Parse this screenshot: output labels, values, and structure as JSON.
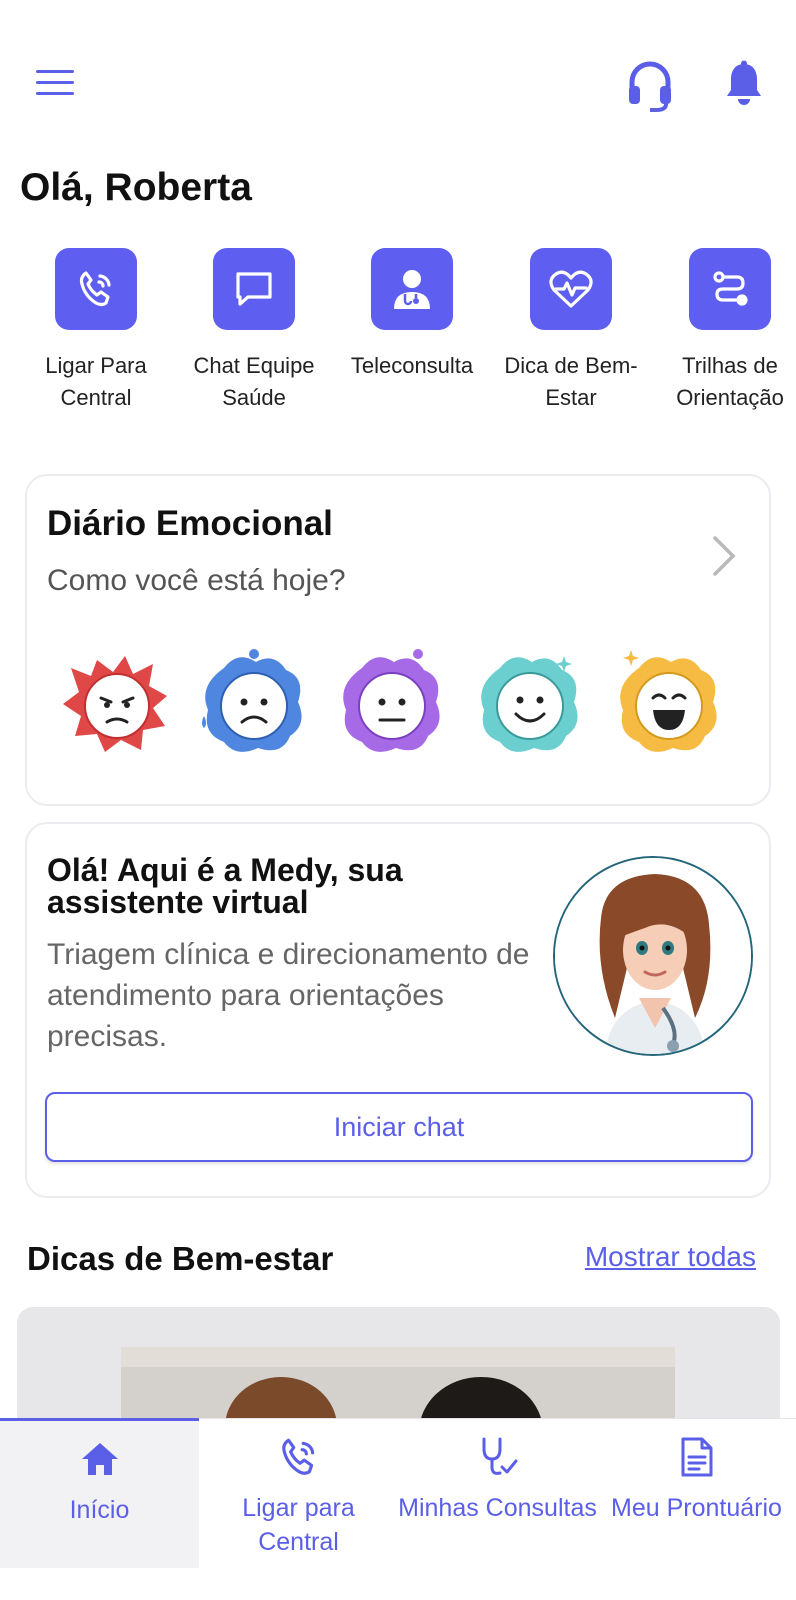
{
  "header": {
    "menu_icon": "hamburger-menu-icon",
    "support_icon": "headset-icon",
    "notifications_icon": "bell-icon",
    "greeting": "Olá, Roberta"
  },
  "shortcuts": [
    {
      "label": "Ligar Para Central",
      "icon": "phone-call-icon"
    },
    {
      "label": "Chat Equipe Saúde",
      "icon": "chat-bubble-icon"
    },
    {
      "label": "Teleconsulta",
      "icon": "doctor-icon"
    },
    {
      "label": "Dica de Bem-Estar",
      "icon": "heart-pulse-icon"
    },
    {
      "label": "Trilhas de Orientação",
      "icon": "route-icon"
    }
  ],
  "diario": {
    "title": "Diário Emocional",
    "subtitle": "Como você está hoje?",
    "moods": [
      "angry",
      "sad",
      "neutral",
      "happy",
      "very-happy"
    ]
  },
  "assistant": {
    "title": "Olá! Aqui é a Medy, sua assistente virtual",
    "description": "Triagem clínica e direcionamento de atendimento para orientações precisas.",
    "button_label": "Iniciar chat"
  },
  "dicas": {
    "title": "Dicas de Bem-estar",
    "show_all": "Mostrar todas"
  },
  "bottom_nav": [
    {
      "label": "Início",
      "icon": "home-icon",
      "active": true
    },
    {
      "label": "Ligar para Central",
      "icon": "phone-call-icon",
      "active": false
    },
    {
      "label": "Minhas Consultas",
      "icon": "stethoscope-icon",
      "active": false
    },
    {
      "label": "Meu Prontuário",
      "icon": "document-icon",
      "active": false
    }
  ],
  "colors": {
    "accent": "#5b5fe8",
    "tile": "#5e5ff0",
    "angry": "#e04848",
    "sad": "#4f86e0",
    "neutral": "#a66ae6",
    "happy": "#6ccfcf",
    "very_happy": "#f6bb42"
  }
}
